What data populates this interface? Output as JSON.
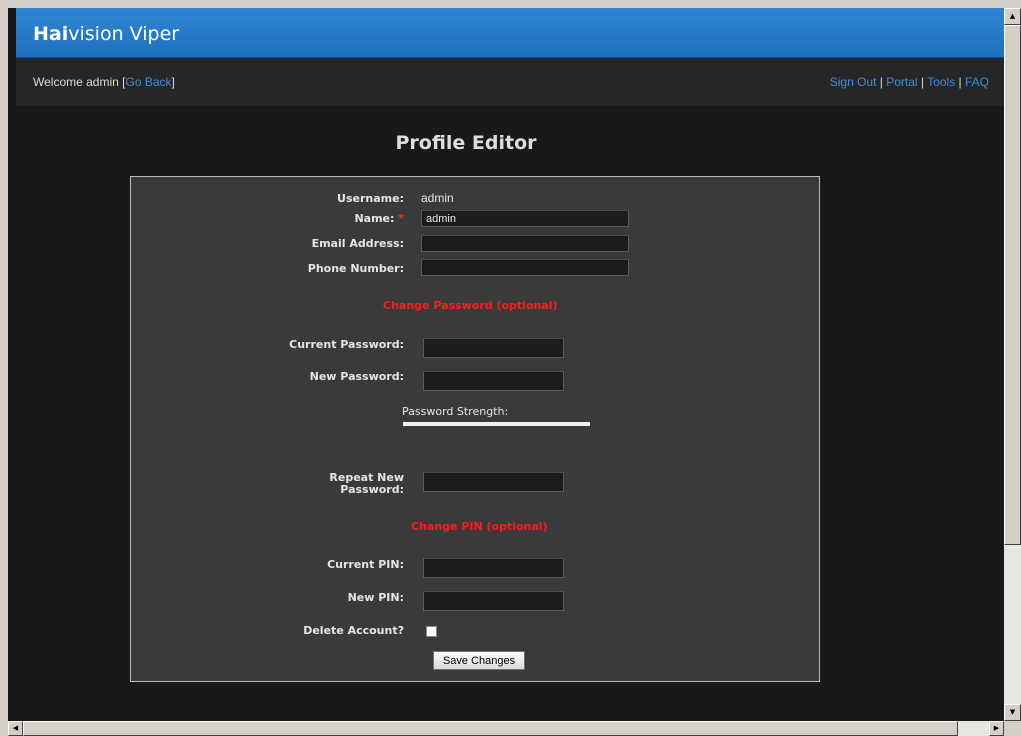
{
  "app": {
    "brand_bold": "Hai",
    "brand_rest": "vision Viper"
  },
  "welcome_bar": {
    "welcome_text": "Welcome admin",
    "go_back_label": "Go Back",
    "links": [
      "Sign Out",
      "Portal",
      "Tools",
      "FAQ"
    ]
  },
  "page": {
    "title": "Profile Editor"
  },
  "form": {
    "username_label": "Username:",
    "username_value": "admin",
    "name_label": "Name:",
    "name_required_mark": "*",
    "name_value": "admin",
    "email_label": "Email Address:",
    "email_value": "",
    "phone_label": "Phone Number:",
    "phone_value": "",
    "change_password_heading": "Change Password (optional)",
    "current_password_label": "Current Password:",
    "new_password_label": "New Password:",
    "password_strength_label": "Password Strength:",
    "repeat_password_label_line1": "Repeat New",
    "repeat_password_label_line2": "Password:",
    "change_pin_heading": "Change PIN (optional)",
    "current_pin_label": "Current PIN:",
    "new_pin_label": "New PIN:",
    "delete_account_label": "Delete Account?",
    "delete_account_checked": false,
    "save_button_label": "Save Changes"
  },
  "colors": {
    "brand_bar": "#2a80d0",
    "link": "#3d8fdc",
    "section_heading": "#ff1a1a",
    "panel": "#3a3a3a",
    "page_background": "#191919"
  },
  "icons": {
    "scroll_up": "triangle-up-icon",
    "scroll_down": "triangle-down-icon",
    "scroll_left": "triangle-left-icon",
    "scroll_right": "triangle-right-icon"
  }
}
